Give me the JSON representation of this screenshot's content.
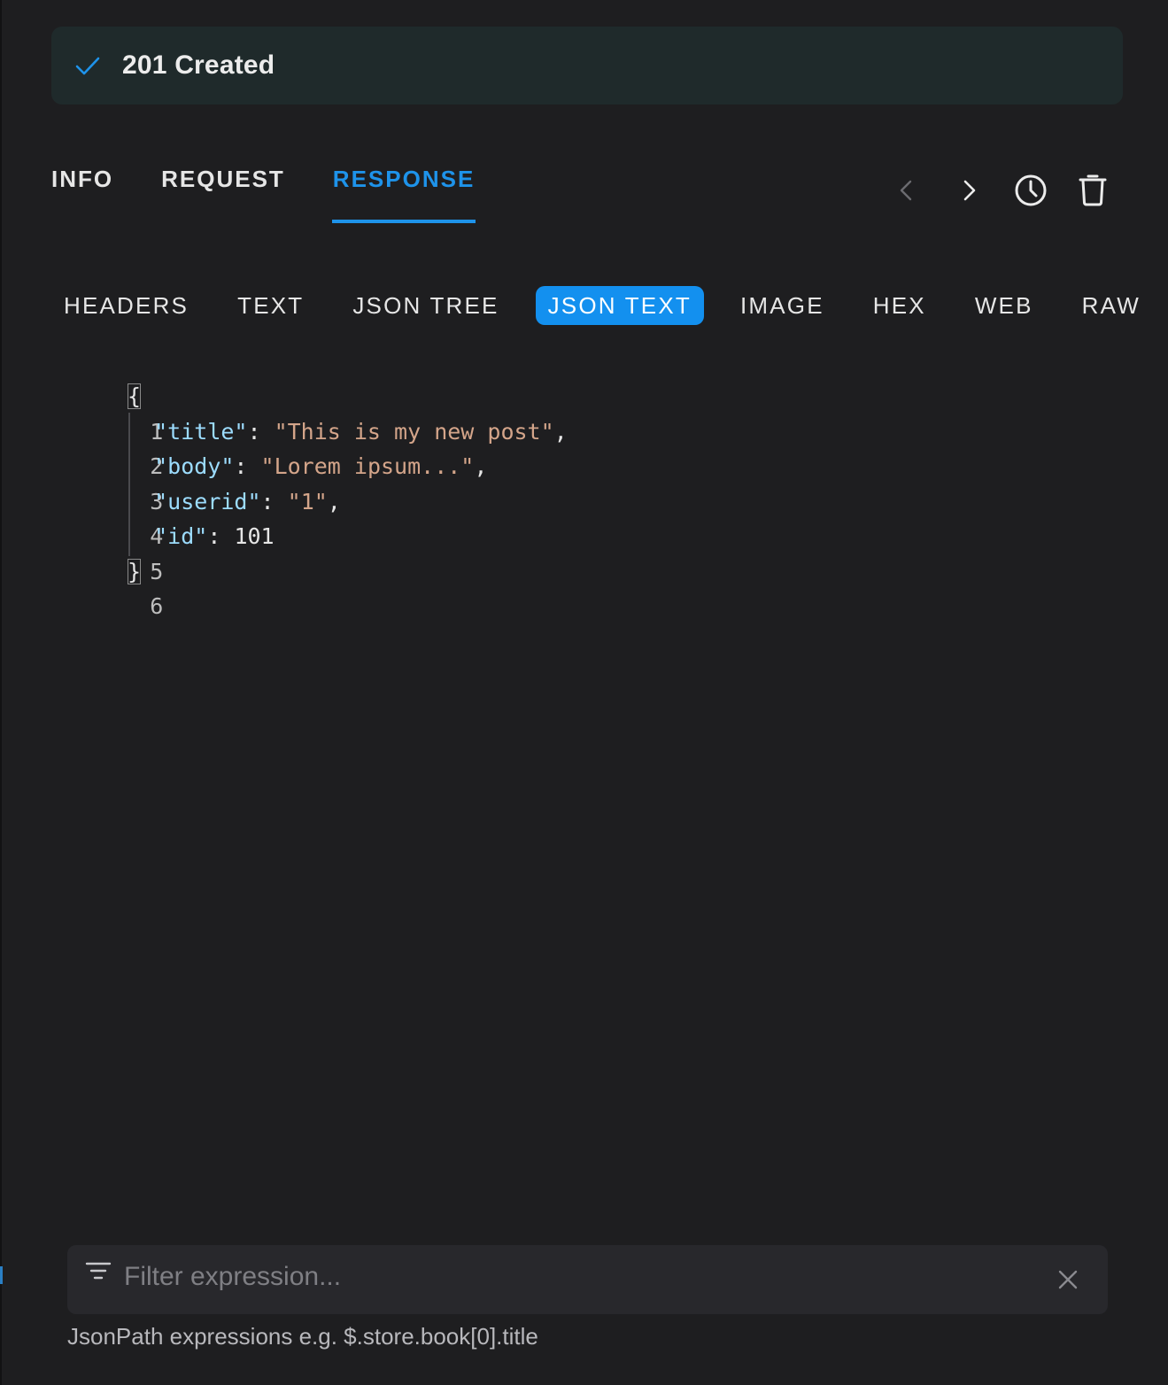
{
  "status": {
    "icon": "check-icon",
    "text": "201 Created",
    "color": "#1e93ea"
  },
  "main_tabs": [
    {
      "label": "INFO",
      "active": false
    },
    {
      "label": "REQUEST",
      "active": false
    },
    {
      "label": "RESPONSE",
      "active": true
    }
  ],
  "toolbar": {
    "prev_icon": "chevron-left-icon",
    "next_icon": "chevron-right-icon",
    "history_icon": "clock-icon",
    "delete_icon": "trash-icon"
  },
  "sub_tabs": [
    {
      "label": "HEADERS",
      "active": false
    },
    {
      "label": "TEXT",
      "active": false
    },
    {
      "label": "JSON TREE",
      "active": false
    },
    {
      "label": "JSON TEXT",
      "active": true
    },
    {
      "label": "IMAGE",
      "active": false
    },
    {
      "label": "HEX",
      "active": false
    },
    {
      "label": "WEB",
      "active": false
    },
    {
      "label": "RAW",
      "active": false
    }
  ],
  "code": {
    "line_numbers": [
      "1",
      "2",
      "3",
      "4",
      "5",
      "6"
    ],
    "open_brace": "{",
    "close_brace": "}",
    "entries": [
      {
        "key": "\"title\"",
        "value": "\"This is my new post\"",
        "value_type": "string",
        "trailing": ","
      },
      {
        "key": "\"body\"",
        "value": "\"Lorem ipsum...\"",
        "value_type": "string",
        "trailing": ","
      },
      {
        "key": "\"userid\"",
        "value": "\"1\"",
        "value_type": "string",
        "trailing": ","
      },
      {
        "key": "\"id\"",
        "value": "101",
        "value_type": "number",
        "trailing": ""
      }
    ]
  },
  "filter": {
    "placeholder": "Filter expression...",
    "value": "",
    "hint": "JsonPath expressions e.g. $.store.book[0].title"
  },
  "colors": {
    "accent": "#1e93ea",
    "json_key": "#9cdcfe",
    "json_string": "#d4a58a",
    "background": "#1e1e20",
    "banner": "#1f2a2b"
  }
}
